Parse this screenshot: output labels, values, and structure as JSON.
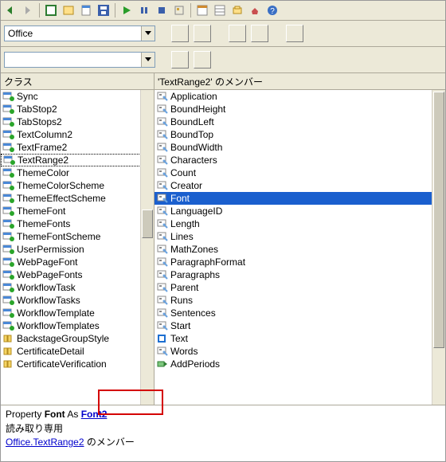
{
  "toolbar": {
    "buttons": [
      "back",
      "forward",
      "excel",
      "word",
      "ppt",
      "save",
      "sep",
      "play",
      "stop",
      "reset",
      "sep",
      "search",
      "find",
      "cut",
      "paste",
      "help"
    ]
  },
  "combo_row1": {
    "combo1_value": "Office"
  },
  "combo_row2": {
    "combo1_value": ""
  },
  "classes": {
    "header": "クラス",
    "items": [
      {
        "icon": "class",
        "label": "Sync"
      },
      {
        "icon": "class",
        "label": "TabStop2"
      },
      {
        "icon": "class",
        "label": "TabStops2"
      },
      {
        "icon": "class",
        "label": "TextColumn2"
      },
      {
        "icon": "class",
        "label": "TextFrame2"
      },
      {
        "icon": "class",
        "label": "TextRange2",
        "selected": true
      },
      {
        "icon": "class",
        "label": "ThemeColor"
      },
      {
        "icon": "class",
        "label": "ThemeColorScheme"
      },
      {
        "icon": "class",
        "label": "ThemeEffectScheme"
      },
      {
        "icon": "class",
        "label": "ThemeFont"
      },
      {
        "icon": "class",
        "label": "ThemeFonts"
      },
      {
        "icon": "class",
        "label": "ThemeFontScheme"
      },
      {
        "icon": "class",
        "label": "UserPermission"
      },
      {
        "icon": "class",
        "label": "WebPageFont"
      },
      {
        "icon": "class",
        "label": "WebPageFonts"
      },
      {
        "icon": "class",
        "label": "WorkflowTask"
      },
      {
        "icon": "class",
        "label": "WorkflowTasks"
      },
      {
        "icon": "class",
        "label": "WorkflowTemplate"
      },
      {
        "icon": "class",
        "label": "WorkflowTemplates"
      },
      {
        "icon": "const",
        "label": "BackstageGroupStyle"
      },
      {
        "icon": "const",
        "label": "CertificateDetail"
      },
      {
        "icon": "const",
        "label": "CertificateVerification"
      }
    ]
  },
  "members": {
    "header": "'TextRange2' のメンバー",
    "items": [
      {
        "icon": "prop",
        "label": "Application"
      },
      {
        "icon": "prop",
        "label": "BoundHeight"
      },
      {
        "icon": "prop",
        "label": "BoundLeft"
      },
      {
        "icon": "prop",
        "label": "BoundTop"
      },
      {
        "icon": "prop",
        "label": "BoundWidth"
      },
      {
        "icon": "prop",
        "label": "Characters"
      },
      {
        "icon": "prop",
        "label": "Count"
      },
      {
        "icon": "prop",
        "label": "Creator"
      },
      {
        "icon": "prop",
        "label": "Font",
        "highlighted": true
      },
      {
        "icon": "prop",
        "label": "LanguageID"
      },
      {
        "icon": "prop",
        "label": "Length"
      },
      {
        "icon": "prop",
        "label": "Lines"
      },
      {
        "icon": "prop",
        "label": "MathZones"
      },
      {
        "icon": "prop",
        "label": "ParagraphFormat"
      },
      {
        "icon": "prop",
        "label": "Paragraphs"
      },
      {
        "icon": "prop",
        "label": "Parent"
      },
      {
        "icon": "prop",
        "label": "Runs"
      },
      {
        "icon": "prop",
        "label": "Sentences"
      },
      {
        "icon": "prop",
        "label": "Start"
      },
      {
        "icon": "propdef",
        "label": "Text"
      },
      {
        "icon": "prop",
        "label": "Words"
      },
      {
        "icon": "method",
        "label": "AddPeriods"
      }
    ]
  },
  "detail": {
    "prefix": "Property ",
    "name": "Font",
    "as": " As ",
    "type": "Font2",
    "readonly": "読み取り専用",
    "member_link": "Office.TextRange2",
    "member_suffix": " のメンバー"
  }
}
